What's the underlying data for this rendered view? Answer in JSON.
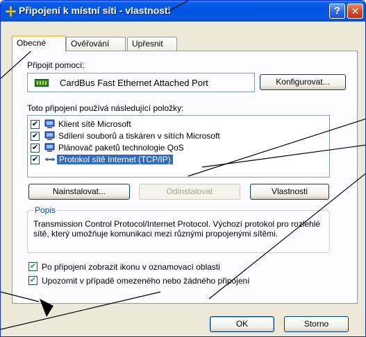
{
  "window": {
    "title": "Připojení k místní síti - vlastnosti",
    "help_glyph": "?",
    "close_glyph": "✕"
  },
  "tabs": [
    {
      "label": "Obecné",
      "active": true
    },
    {
      "label": "Ověřování",
      "active": false
    },
    {
      "label": "Upřesnit",
      "active": false
    }
  ],
  "general": {
    "connect_using_label": "Připojit pomocí:",
    "adapter_name": "CardBus Fast Ethernet Attached Port",
    "configure_button": "Konfigurovat...",
    "items_label": "Toto připojení používá následující položky:",
    "items": [
      {
        "label": "Klient sítě Microsoft",
        "checked": true,
        "selected": false,
        "check_glyph": "✔"
      },
      {
        "label": "Sdílení souborů a tiskáren v sítích Microsoft",
        "checked": true,
        "selected": false,
        "check_glyph": "✔"
      },
      {
        "label": "Plánovač paketů technologie QoS",
        "checked": true,
        "selected": false,
        "check_glyph": "✔"
      },
      {
        "label": "Protokol sítě Internet (TCP/IP)",
        "checked": true,
        "selected": true,
        "check_glyph": "✔"
      }
    ],
    "install_button": "Nainstalovat...",
    "uninstall_button": "Odinstalovat",
    "properties_button": "Vlastnosti",
    "description_title": "Popis",
    "description_text": "Transmission Control Protocol/Internet Protocol. Výchozí protokol pro rozlehlé sítě, který umožňuje komunikaci mezi různými propojenými sítěmi.",
    "option_show_icon": {
      "label": "Po připojení zobrazit ikonu v oznamovací oblasti",
      "checked": true,
      "check_glyph": "✔"
    },
    "option_notify": {
      "label": "Upozornit v případě omezeného nebo žádného připojení",
      "checked": true,
      "check_glyph": "✔"
    }
  },
  "footer": {
    "ok_button": "OK",
    "cancel_button": "Storno"
  },
  "colors": {
    "titlebar": "#0054e3",
    "selection": "#316ac5",
    "group_title": "#0046d5",
    "checkmark": "#21a121"
  }
}
